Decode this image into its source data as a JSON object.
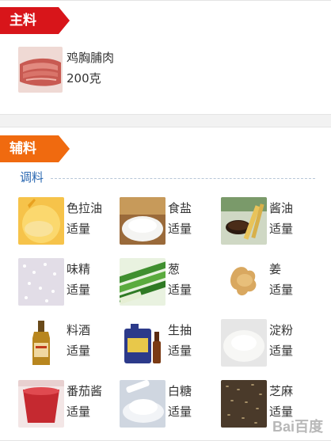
{
  "main_section": {
    "ribbon_label": "主料",
    "ingredient": {
      "name": "鸡胸脯肉",
      "amount": "200克",
      "icon": "chicken-breast-photo"
    }
  },
  "aux_section": {
    "ribbon_label": "辅料",
    "subheading": "调料",
    "ingredients": [
      {
        "name": "色拉油",
        "amount": "适量",
        "icon": "salad-oil-photo"
      },
      {
        "name": "食盐",
        "amount": "适量",
        "icon": "salt-photo"
      },
      {
        "name": "酱油",
        "amount": "适量",
        "icon": "soy-sauce-photo"
      },
      {
        "name": "味精",
        "amount": "适量",
        "icon": "msg-photo"
      },
      {
        "name": "葱",
        "amount": "适量",
        "icon": "scallion-photo"
      },
      {
        "name": "姜",
        "amount": "适量",
        "icon": "ginger-photo"
      },
      {
        "name": "料酒",
        "amount": "适量",
        "icon": "cooking-wine-photo"
      },
      {
        "name": "生抽",
        "amount": "适量",
        "icon": "light-soy-photo"
      },
      {
        "name": "淀粉",
        "amount": "适量",
        "icon": "starch-photo"
      },
      {
        "name": "番茄酱",
        "amount": "适量",
        "icon": "ketchup-photo"
      },
      {
        "name": "白糖",
        "amount": "适量",
        "icon": "sugar-photo"
      },
      {
        "name": "芝麻",
        "amount": "适量",
        "icon": "sesame-photo"
      }
    ]
  },
  "watermark": "Bai百度"
}
